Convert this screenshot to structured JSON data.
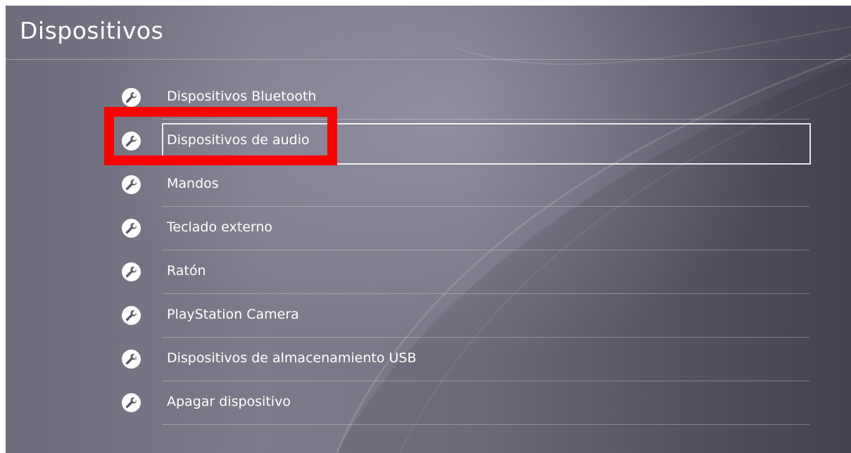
{
  "page": {
    "title": "Dispositivos"
  },
  "menu": {
    "focused_index": 1,
    "items": [
      {
        "label": "Dispositivos Bluetooth",
        "icon": "wrench-icon"
      },
      {
        "label": "Dispositivos de audio",
        "icon": "wrench-icon"
      },
      {
        "label": "Mandos",
        "icon": "wrench-icon"
      },
      {
        "label": "Teclado externo",
        "icon": "wrench-icon"
      },
      {
        "label": "Ratón",
        "icon": "wrench-icon"
      },
      {
        "label": "PlayStation Camera",
        "icon": "wrench-icon"
      },
      {
        "label": "Dispositivos de almacenamiento USB",
        "icon": "wrench-icon"
      },
      {
        "label": "Apagar dispositivo",
        "icon": "wrench-icon"
      }
    ]
  },
  "annotation": {
    "highlight_color": "#ff0000",
    "highlighted_item": "Dispositivos de audio"
  },
  "colors": {
    "text": "#ffffff",
    "background": "#6e6c7c"
  }
}
